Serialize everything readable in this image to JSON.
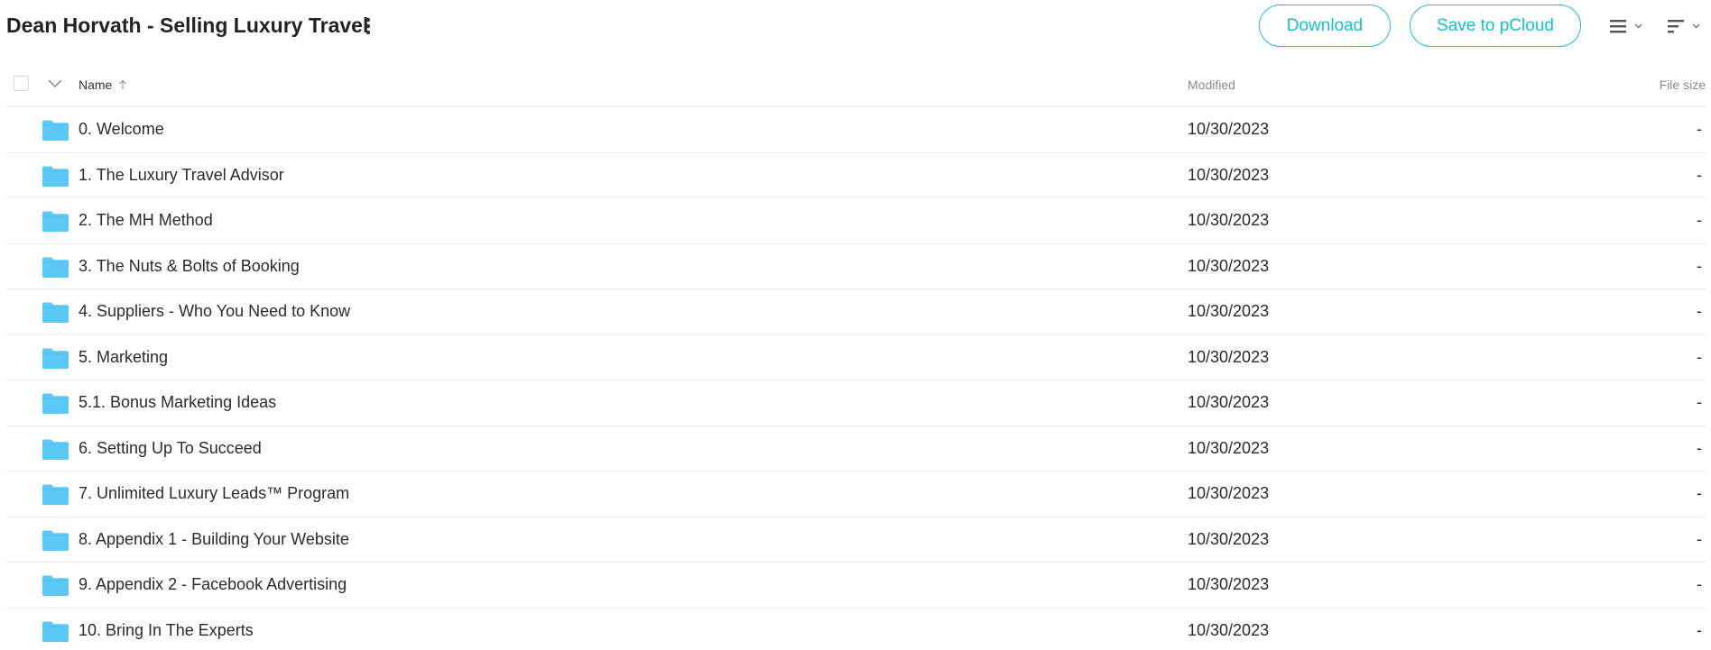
{
  "header": {
    "title": "Dean Horvath - Selling Luxury Travel",
    "download_label": "Download",
    "save_label": "Save to pCloud",
    "more_icon": "kebab-menu-icon",
    "list_view_icon": "list-view-icon",
    "sort_icon": "sort-icon"
  },
  "colors": {
    "accent": "#17bed0",
    "folder": "#5bc8f5",
    "folder_tab": "#4bbcec"
  },
  "table": {
    "columns": {
      "name": "Name",
      "modified": "Modified",
      "size": "File size"
    },
    "sort": "ascending",
    "rows": [
      {
        "name": "0. Welcome",
        "modified": "10/30/2023",
        "size": "-"
      },
      {
        "name": "1. The Luxury Travel Advisor",
        "modified": "10/30/2023",
        "size": "-"
      },
      {
        "name": "2. The MH Method",
        "modified": "10/30/2023",
        "size": "-"
      },
      {
        "name": "3. The Nuts & Bolts of Booking",
        "modified": "10/30/2023",
        "size": "-"
      },
      {
        "name": "4. Suppliers - Who You Need to Know",
        "modified": "10/30/2023",
        "size": "-"
      },
      {
        "name": "5. Marketing",
        "modified": "10/30/2023",
        "size": "-"
      },
      {
        "name": "5.1. Bonus Marketing Ideas",
        "modified": "10/30/2023",
        "size": "-"
      },
      {
        "name": "6. Setting Up To Succeed",
        "modified": "10/30/2023",
        "size": "-"
      },
      {
        "name": "7. Unlimited Luxury Leads™ Program",
        "modified": "10/30/2023",
        "size": "-"
      },
      {
        "name": "8. Appendix 1 - Building Your Website",
        "modified": "10/30/2023",
        "size": "-"
      },
      {
        "name": "9. Appendix 2 - Facebook Advertising",
        "modified": "10/30/2023",
        "size": "-"
      },
      {
        "name": "10. Bring In The Experts",
        "modified": "10/30/2023",
        "size": "-"
      }
    ]
  }
}
